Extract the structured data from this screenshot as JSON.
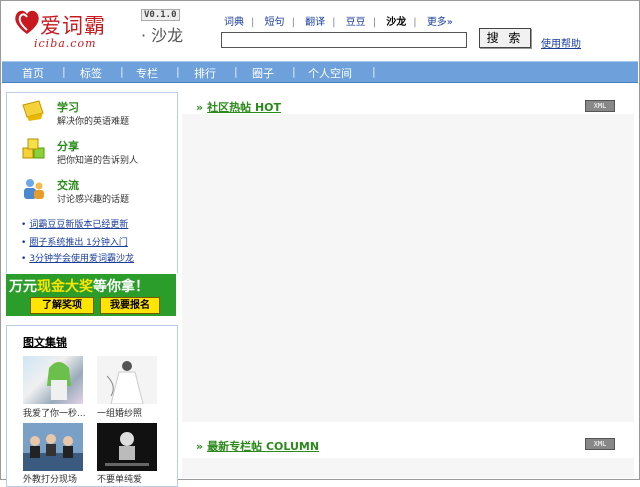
{
  "header": {
    "logo_brand": "爱词霸",
    "logo_domain": "iciba.com",
    "version": "V0.1.0",
    "section_name": "· 沙龙",
    "nav": [
      {
        "label": "词典",
        "current": false
      },
      {
        "label": "短句",
        "current": false
      },
      {
        "label": "翻译",
        "current": false
      },
      {
        "label": "豆豆",
        "current": false
      },
      {
        "label": "沙龙",
        "current": true
      },
      {
        "label": "更多»",
        "current": false
      }
    ],
    "search_value": "",
    "search_button": "搜 索",
    "help_link": "使用帮助"
  },
  "navbar": {
    "items": [
      "首页",
      "标签",
      "专栏",
      "排行",
      "圈子",
      "个人空间"
    ]
  },
  "sidebar": {
    "features": [
      {
        "title": "学习",
        "desc": "解决你的英语难题",
        "icon": "pencil-icon"
      },
      {
        "title": "分享",
        "desc": "把你知道的告诉别人",
        "icon": "cubes-icon"
      },
      {
        "title": "交流",
        "desc": "讨论感兴趣的话题",
        "icon": "people-icon"
      }
    ],
    "news": [
      "词霸豆豆新版本已经更新",
      "圈子系统推出 1分钟入门",
      "3分钟学会使用爱词霸沙龙"
    ],
    "banner": {
      "text_prefix": "万元",
      "text_highlight": "现金大奖",
      "text_suffix": "等你拿！",
      "button1": "了解奖项",
      "button2": "我要报名"
    },
    "gallery": {
      "title": "图文集锦",
      "items": [
        "我爱了你一秒...",
        "一组婚纱照",
        "外教打分现场",
        "不要单纯爱"
      ]
    }
  },
  "main": {
    "sections": [
      {
        "title": "社区热帖 HOT",
        "badge": "XML"
      },
      {
        "title": "最新专栏帖 COLUMN",
        "badge": "XML"
      }
    ]
  },
  "colors": {
    "brand_red": "#c8191e",
    "nav_blue": "#6ea0dc",
    "accent_green": "#2a8a1a",
    "link_blue": "#1a3d9e",
    "banner_green": "#2a9d2a",
    "banner_yellow": "#ffe400"
  }
}
